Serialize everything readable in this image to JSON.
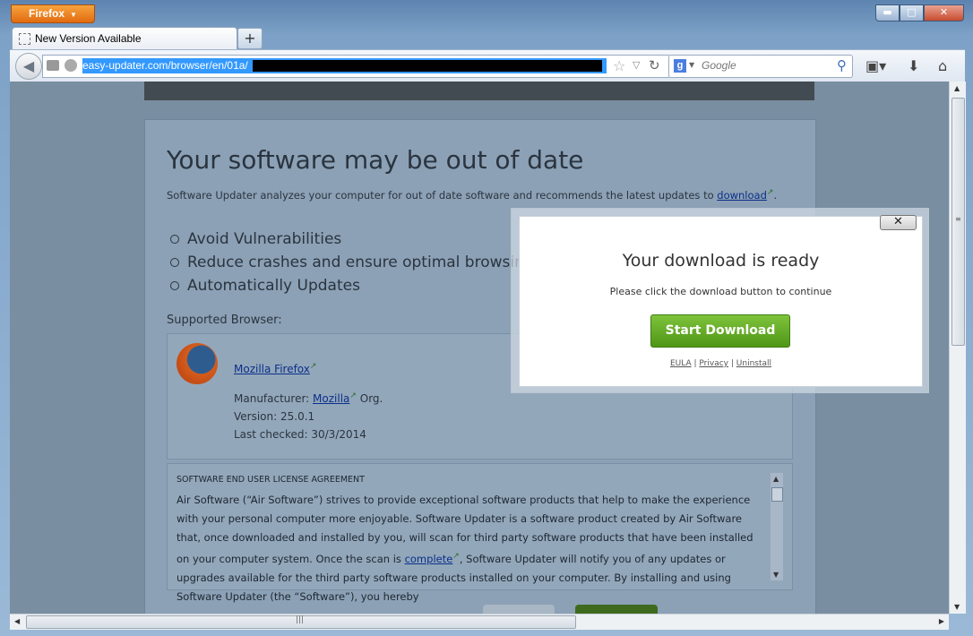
{
  "window": {
    "app_button_label": "Firefox",
    "min_label": "▬",
    "max_label": "□",
    "close_label": "✕"
  },
  "tabs": [
    {
      "label": "New Version Available"
    }
  ],
  "newtab_label": "+",
  "urlbar": {
    "url": "easy-updater.com/browser/en/01a/"
  },
  "searchbar": {
    "engine_letter": "g",
    "placeholder": "Google"
  },
  "page": {
    "heading": "Your software may be out of date",
    "intro_prefix": "Software Updater analyzes your computer for out of date software and recommends the latest updates to ",
    "intro_link": "download",
    "intro_suffix": ".",
    "bullets": [
      "Avoid Vulnerabilities",
      "Reduce crashes and ensure optimal browsing",
      "Automatically Updates"
    ],
    "supported_label": "Supported Browser:",
    "browser": {
      "name": "Mozilla Firefox",
      "manufacturer_label": "Manufacturer: ",
      "manufacturer_link": "Mozilla",
      "manufacturer_suffix": " Org.",
      "version": "Version: 25.0.1",
      "last_checked": "Last checked: 30/3/2014"
    },
    "eula": {
      "title": "SOFTWARE END USER LICENSE AGREEMENT",
      "body_1": "Air Software (“Air Software”) strives to provide exceptional software products that help to make the experience with your personal computer more enjoyable. Software Updater is a software product created by Air Software that, once downloaded and installed by you, will scan for third party software products that have been installed on your computer system. Once the scan is ",
      "body_link": "complete",
      "body_2": ", Software Updater will notify you of any updates or upgrades available for the third party software products installed on your computer. By installing and using Software Updater (the “Software”), you hereby"
    }
  },
  "dialog": {
    "close_label": "✕",
    "title": "Your download is ready",
    "subtitle": "Please click the download button to continue",
    "button_label": "Start Download",
    "links": [
      "EULA",
      "Privacy",
      "Uninstall"
    ],
    "separator": "|"
  }
}
